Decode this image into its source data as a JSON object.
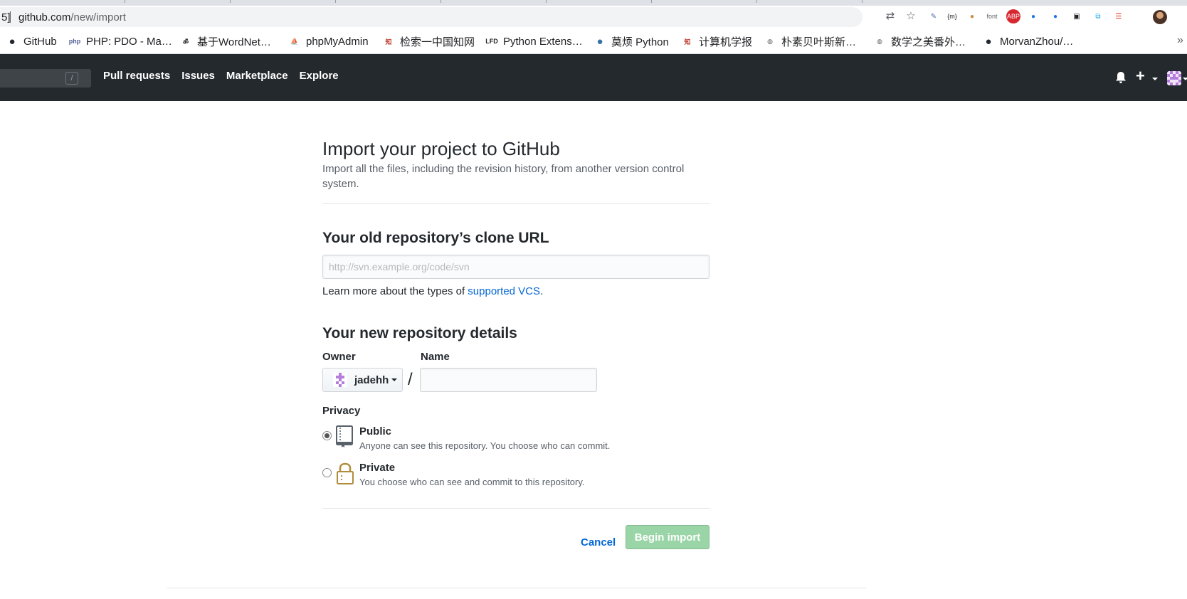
{
  "browser": {
    "omnibox": {
      "leading_fragment": "5]",
      "host": "github.com",
      "path": "/new/import"
    },
    "extensions": [
      {
        "icon": "translate-icon",
        "glyph": "⇄",
        "color": "#5f6368"
      },
      {
        "icon": "star-icon",
        "glyph": "☆",
        "color": "#5f6368"
      },
      {
        "icon": "pencil-circle-icon",
        "glyph": "✎",
        "color": "#4a6fa5"
      },
      {
        "icon": "json-viewer-icon",
        "glyph": "{m}",
        "color": "#202124"
      },
      {
        "icon": "cookie-icon",
        "glyph": "●",
        "color": "#c58a3c"
      },
      {
        "icon": "font-icon",
        "glyph": "font",
        "color": "#5f6368"
      },
      {
        "icon": "adblock-icon",
        "glyph": "ABP",
        "color": "#fff",
        "bg": "#d7282f"
      },
      {
        "icon": "bulb-icon",
        "glyph": "●",
        "color": "#1a73e8"
      },
      {
        "icon": "bulb-icon",
        "glyph": "●",
        "color": "#1a73e8"
      },
      {
        "icon": "tab-icon",
        "glyph": "▣",
        "color": "#202124"
      },
      {
        "icon": "screenshot-icon",
        "glyph": "⧉",
        "color": "#12a4e0"
      },
      {
        "icon": "reader-icon",
        "glyph": "☰",
        "color": "#d93025"
      }
    ],
    "bookmarks": [
      {
        "label": "GitHub",
        "icon": "github-icon",
        "glyph": "●",
        "color": "#24292e"
      },
      {
        "label": "PHP: PDO - Ma…",
        "icon": "php-icon",
        "glyph": "php",
        "color": "#4f5b93"
      },
      {
        "label": "基于WordNet…",
        "icon": "om-icon",
        "glyph": "ॐ",
        "color": "#202124"
      },
      {
        "label": "phpMyAdmin",
        "icon": "phpmyadmin-icon",
        "glyph": "⛵",
        "color": "#e8a03e"
      },
      {
        "label": "检索一中国知网",
        "icon": "cnki-icon",
        "glyph": "知",
        "color": "#c0392b"
      },
      {
        "label": "Python Extens…",
        "icon": "lfd-icon",
        "glyph": "LFD",
        "color": "#202124"
      },
      {
        "label": "莫烦 Python",
        "icon": "python-icon",
        "glyph": "●",
        "color": "#3572a5"
      },
      {
        "label": "计算机学报",
        "icon": "cnki-icon",
        "glyph": "知",
        "color": "#c0392b"
      },
      {
        "label": "朴素贝叶斯新…",
        "icon": "globe-icon",
        "glyph": "◍",
        "color": "#5f6368"
      },
      {
        "label": "数学之美番外…",
        "icon": "globe-icon",
        "glyph": "◍",
        "color": "#5f6368"
      },
      {
        "label": "MorvanZhou/…",
        "icon": "github-icon",
        "glyph": "●",
        "color": "#24292e"
      }
    ],
    "more_glyph": "»"
  },
  "header": {
    "search_slash": "/",
    "nav": [
      "Pull requests",
      "Issues",
      "Marketplace",
      "Explore"
    ]
  },
  "page": {
    "title": "Import your project to GitHub",
    "subtitle": "Import all the files, including the revision history, from another version control system.",
    "clone_section": "Your old repository’s clone URL",
    "url_placeholder": "http://svn.example.org/code/svn",
    "learn_more_prefix": "Learn more about the types of ",
    "learn_more_link": "supported VCS",
    "learn_more_suffix": ".",
    "details_section": "Your new repository details",
    "owner_label": "Owner",
    "name_label": "Name",
    "owner_value": "jadehh",
    "slash": "/",
    "privacy_label": "Privacy",
    "public_title": "Public",
    "public_desc": "Anyone can see this repository. You choose who can commit.",
    "private_title": "Private",
    "private_desc": "You choose who can see and commit to this repository.",
    "selected_privacy": "Public",
    "cancel": "Cancel",
    "begin": "Begin import"
  },
  "colors": {
    "header_bg": "#24292e",
    "link": "#0366d6",
    "begin_disabled": "#94d3a2",
    "lock": "#b08d3d"
  }
}
